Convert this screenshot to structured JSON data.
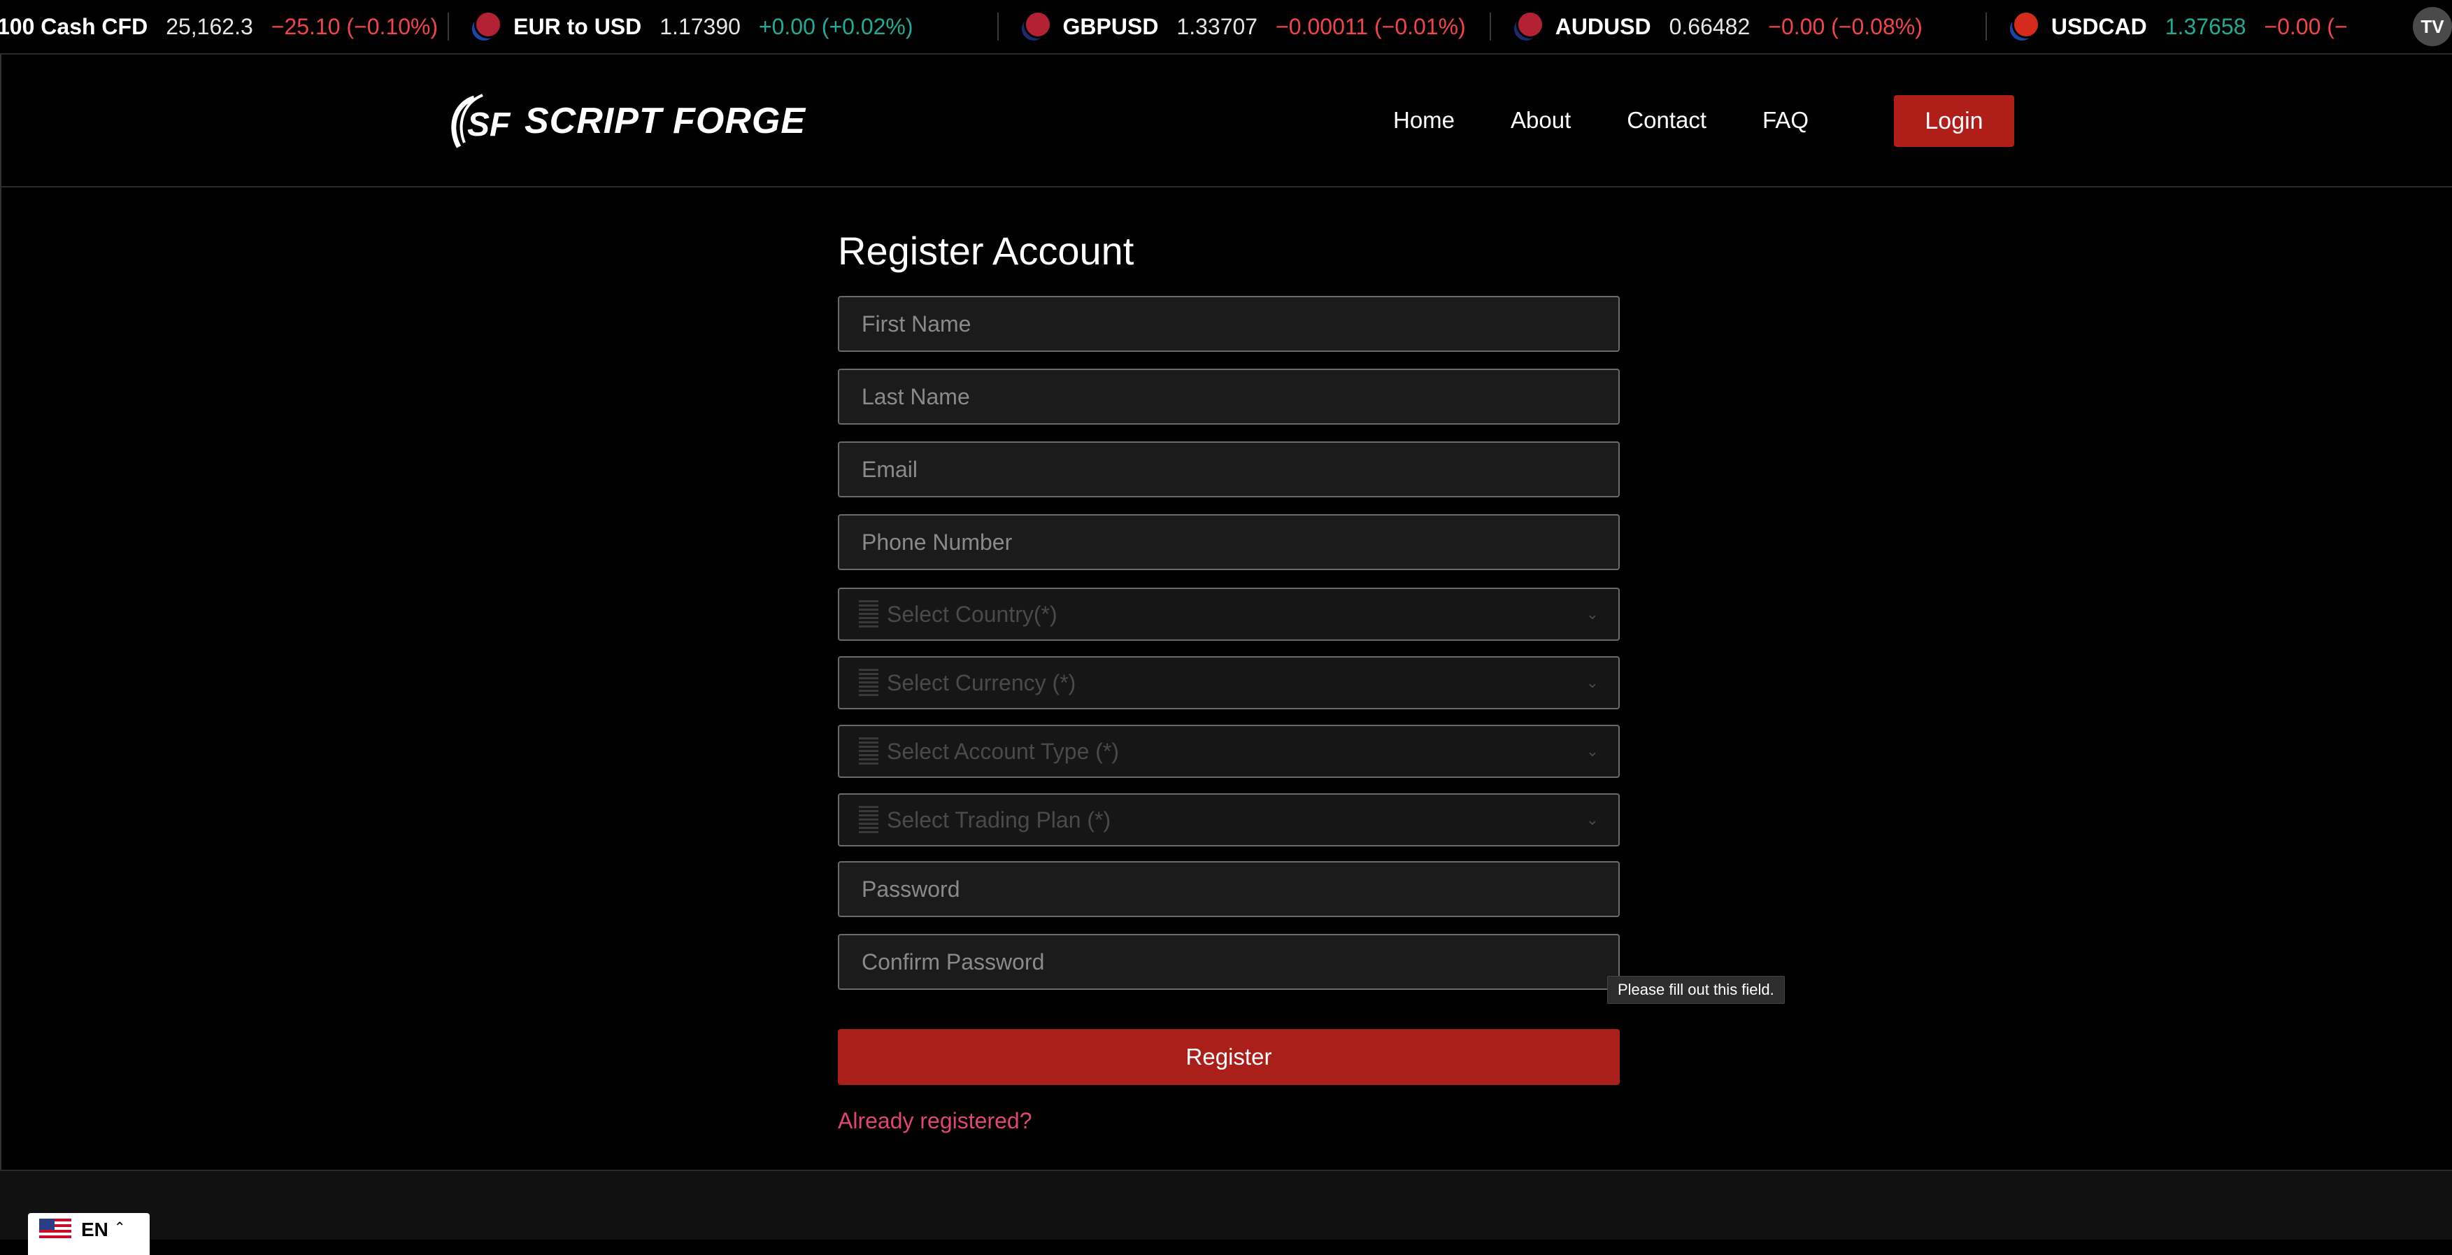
{
  "ticker": {
    "items": [
      {
        "symbol": "100 Cash CFD",
        "price": "25,162.3",
        "change": "−25.10 (−0.10%)",
        "direction": "neg",
        "flags": []
      },
      {
        "symbol": "EUR to USD",
        "price": "1.17390",
        "change": "+0.00 (+0.02%)",
        "direction": "pos",
        "flags": [
          "#1a46a8",
          "#b22234"
        ]
      },
      {
        "symbol": "GBPUSD",
        "price": "1.33707",
        "change": "−0.00011 (−0.01%)",
        "direction": "neg",
        "flags": [
          "#1a2a6c",
          "#b22234"
        ]
      },
      {
        "symbol": "AUDUSD",
        "price": "0.66482",
        "change": "−0.00 (−0.08%)",
        "direction": "neg",
        "flags": [
          "#1a2a6c",
          "#b22234"
        ]
      },
      {
        "symbol": "USDCAD",
        "price": "1.37658",
        "change": "−0.00 (−",
        "direction": "neg",
        "price_color": "#22ab94",
        "flags": [
          "#b22234",
          "#d52b1e"
        ]
      }
    ],
    "badge": "TV"
  },
  "header": {
    "logo_text": "SCRIPT FORGE",
    "nav": [
      {
        "label": "Home"
      },
      {
        "label": "About"
      },
      {
        "label": "Contact"
      },
      {
        "label": "FAQ"
      }
    ],
    "login_label": "Login"
  },
  "form": {
    "title": "Register Account",
    "fields": {
      "first_name": "First Name",
      "last_name": "Last Name",
      "email": "Email",
      "phone": "Phone Number",
      "password": "Password",
      "confirm_password": "Confirm Password"
    },
    "selects": {
      "country": "Select Country(*)",
      "currency": "Select Currency (*)",
      "account_type": "Select Account Type (*)",
      "trading_plan": "Select Trading Plan (*)"
    },
    "register_label": "Register",
    "already_label": "Already registered?",
    "tooltip": "Please fill out this field."
  },
  "footer": {
    "language": "EN"
  },
  "colors": {
    "accent": "#ab1f1a",
    "link": "#e0457a",
    "negative": "#f2454b",
    "positive": "#22ab94"
  }
}
